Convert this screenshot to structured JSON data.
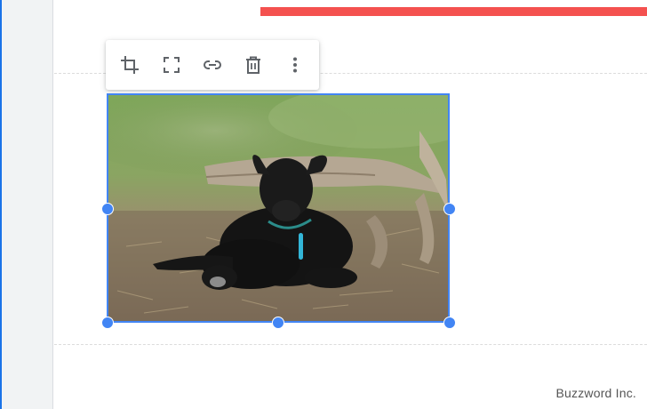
{
  "toolbar": {
    "buttons": [
      {
        "icon": "crop-icon"
      },
      {
        "icon": "fullscreen-icon"
      },
      {
        "icon": "link-icon"
      },
      {
        "icon": "delete-icon"
      },
      {
        "icon": "more-vert-icon"
      }
    ]
  },
  "image": {
    "subject": "black-lamb-photo"
  },
  "watermark": "Buzzword Inc.",
  "colors": {
    "accent": "#4285f4",
    "red_bar": "#f4514f",
    "sidebar_bg": "#f1f3f4"
  }
}
